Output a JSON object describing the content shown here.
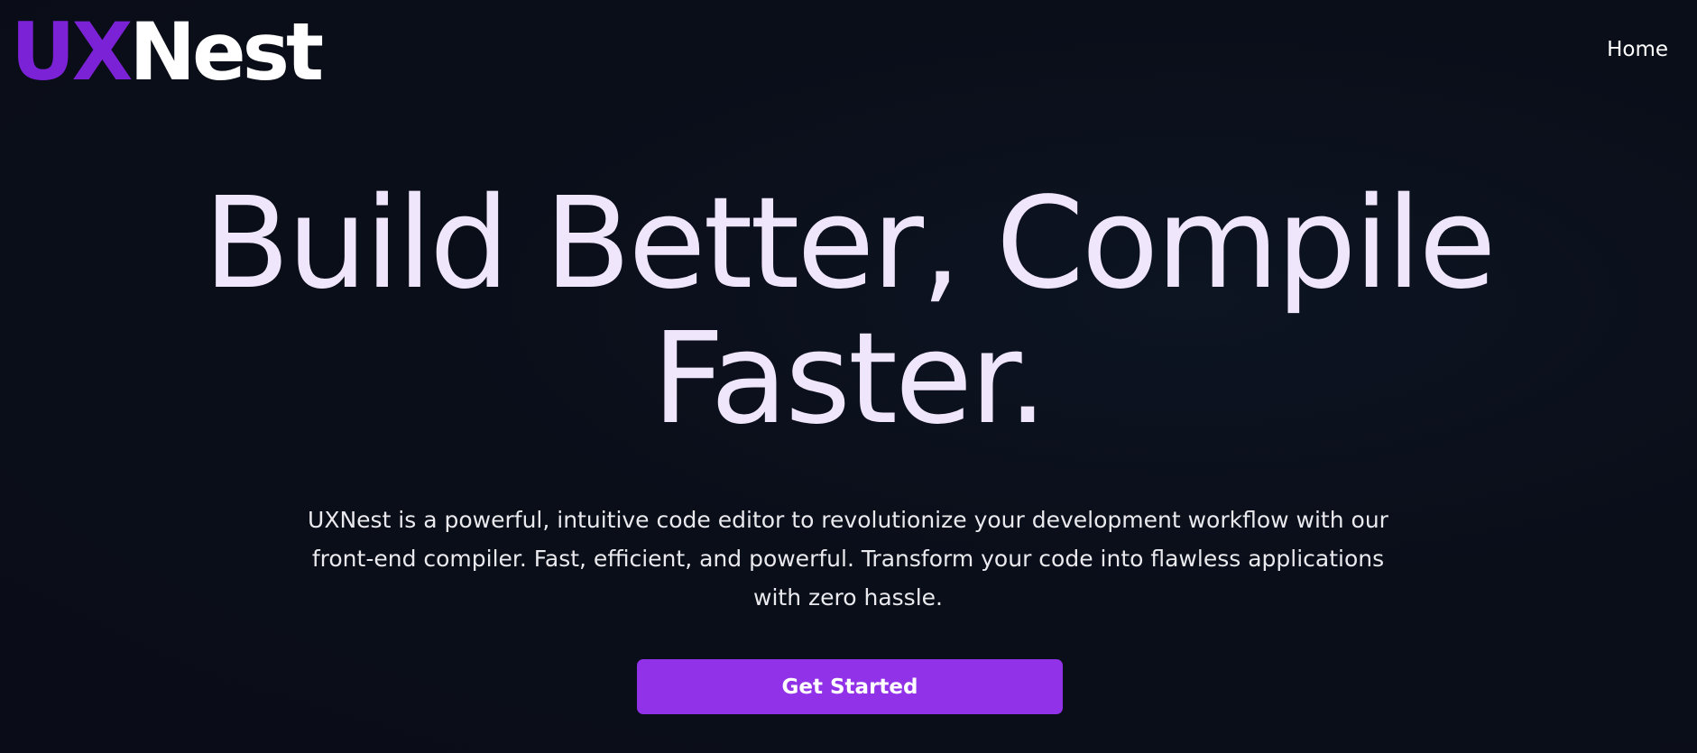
{
  "navbar": {
    "logo_part1": "UX",
    "logo_part2": "Nest",
    "home_link": "Home"
  },
  "hero": {
    "title_line1": "Build Better, Compile",
    "title_line2": "Faster.",
    "description": "UXNest is a powerful, intuitive code editor to revolutionize your development workflow with our front-end compiler. Fast, efficient, and powerful. Transform your code into flawless applications with zero hassle.",
    "cta_label": "Get Started"
  },
  "colors": {
    "background": "#0b0f1a",
    "brand_purple": "#7c22d6",
    "button_purple": "#9131e8",
    "title_text": "#f0e6fb"
  }
}
